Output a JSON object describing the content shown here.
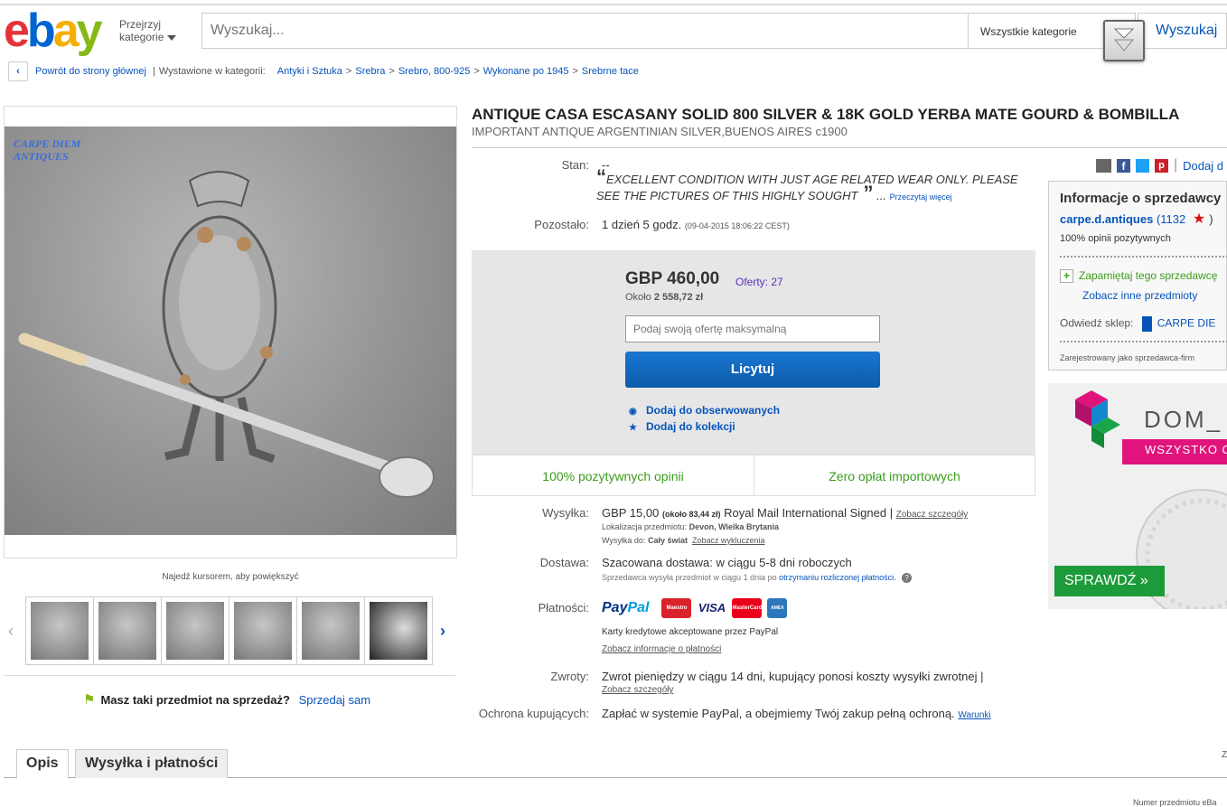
{
  "header": {
    "logo_letters": [
      "e",
      "b",
      "a",
      "y"
    ],
    "browse_line1": "Przejrzyj",
    "browse_line2": "kategorie",
    "search_placeholder": "Wyszukaj...",
    "category_select": "Wszystkie kategorie",
    "search_button": "Wyszukaj"
  },
  "breadcrumb": {
    "back_label": "Powrót do strony głównej",
    "listed_in": "Wystawione w kategorii:",
    "path": [
      "Antyki i Sztuka",
      "Srebra",
      "Srebro, 800-925",
      "Wykonane po 1945",
      "Srebrne tace"
    ]
  },
  "gallery": {
    "watermark_line1": "CARPE DIEM",
    "watermark_line2": "ANTIQUES",
    "zoom_hint": "Najedź kursorem, aby powiększyć",
    "thumbnail_count": 6,
    "sell_question": "Masz taki przedmiot na sprzedaż?",
    "sell_link": "Sprzedaj sam"
  },
  "item": {
    "title": "ANTIQUE CASA ESCASANY SOLID 800 SILVER & 18K GOLD YERBA MATE GOURD & BOMBILLA",
    "subtitle": "IMPORTANT ANTIQUE ARGENTINIAN SILVER,BUENOS AIRES c1900",
    "condition_label": "Stan:",
    "condition_value": "--",
    "condition_quote": "EXCELLENT CONDITION WITH JUST AGE RELATED WEAR ONLY. PLEASE SEE THE PICTURES OF THIS HIGHLY SOUGHT",
    "read_more": "Przeczytaj więcej",
    "time_left_label": "Pozostało:",
    "time_left_value": "1 dzień 5 godz.",
    "end_time": "(09-04-2015  18:06:22 CEST)"
  },
  "bid": {
    "price": "GBP 460,00",
    "offers": "Oferty: 27",
    "approx_prefix": "Około",
    "approx_value": "2 558,72 zł",
    "input_placeholder": "Podaj swoją ofertę maksymalną",
    "bid_button": "Licytuj",
    "watch_link": "Dodaj do obserwowanych",
    "collection_link": "Dodaj do kolekcji",
    "perk_feedback": "100% pozytywnych opinii",
    "perk_import": "Zero opłat importowych"
  },
  "shipping": {
    "label": "Wysyłka:",
    "cost": "GBP 15,00",
    "cost_approx": "(około 83,44 zł)",
    "service": "Royal Mail International Signed |",
    "details_link": "Zobacz szczegóły",
    "location_label": "Lokalizacja przedmiotu:",
    "location_value": "Devon, Wielka Brytania",
    "ships_to_label": "Wysyłka do:",
    "ships_to_value": "Cały świat",
    "exclusions_link": "Zobacz wykluczenia"
  },
  "delivery": {
    "label": "Dostawa:",
    "estimate": "Szacowana dostawa: w ciągu 5-8 dni roboczych",
    "note_prefix": "Sprzedawca wysyła przedmiot w ciągu 1 dnia po",
    "note_link": "otrzymaniu rozliczonej płatności."
  },
  "payments": {
    "label": "Płatności:",
    "paypal_a": "Pay",
    "paypal_b": "Pal",
    "cards": [
      "Maestro",
      "VISA",
      "MasterCard",
      "AMEX"
    ],
    "card_colors": [
      "#d9222a",
      "#1a1f71",
      "#eb001b",
      "#2e77bc"
    ],
    "cards_note": "Karty kredytowe akceptowane przez PayPal",
    "info_link": "Zobacz informacje o płatności"
  },
  "returns": {
    "label": "Zwroty:",
    "text": "Zwrot pieniędzy w ciągu 14 dni, kupujący ponosi koszty wysyłki zwrotnej |",
    "details_link": "Zobacz szczegóły"
  },
  "protection": {
    "label": "Ochrona kupujących:",
    "text": "Zapłać w systemie PayPal, a obejmiemy Twój zakup pełną ochroną.",
    "terms_link": "Warunki"
  },
  "share": {
    "add_link": "Dodaj d"
  },
  "seller": {
    "title": "Informacje o sprzedawcy",
    "name": "carpe.d.antiques",
    "feedback_score": "(1132",
    "feedback_close": ")",
    "positive": "100% opinii pozytywnych",
    "save_seller": "Zapamiętaj tego sprzedawcę",
    "other_items": "Zobacz inne przedmioty",
    "store_label": "Odwiedź sklep:",
    "store_name": "CARPE DIE",
    "registered": "Zarejestrowany jako sprzedawca-firm"
  },
  "ad": {
    "brand": "DOM_",
    "banner": "WSZYSTKO O",
    "cta": "SPRAWDŹ »"
  },
  "tabs": {
    "description": "Opis",
    "shipping_payments": "Wysyłka i płatności"
  },
  "footer": {
    "item_number": "Numer przedmiotu eBa",
    "edge_char": "Z"
  }
}
